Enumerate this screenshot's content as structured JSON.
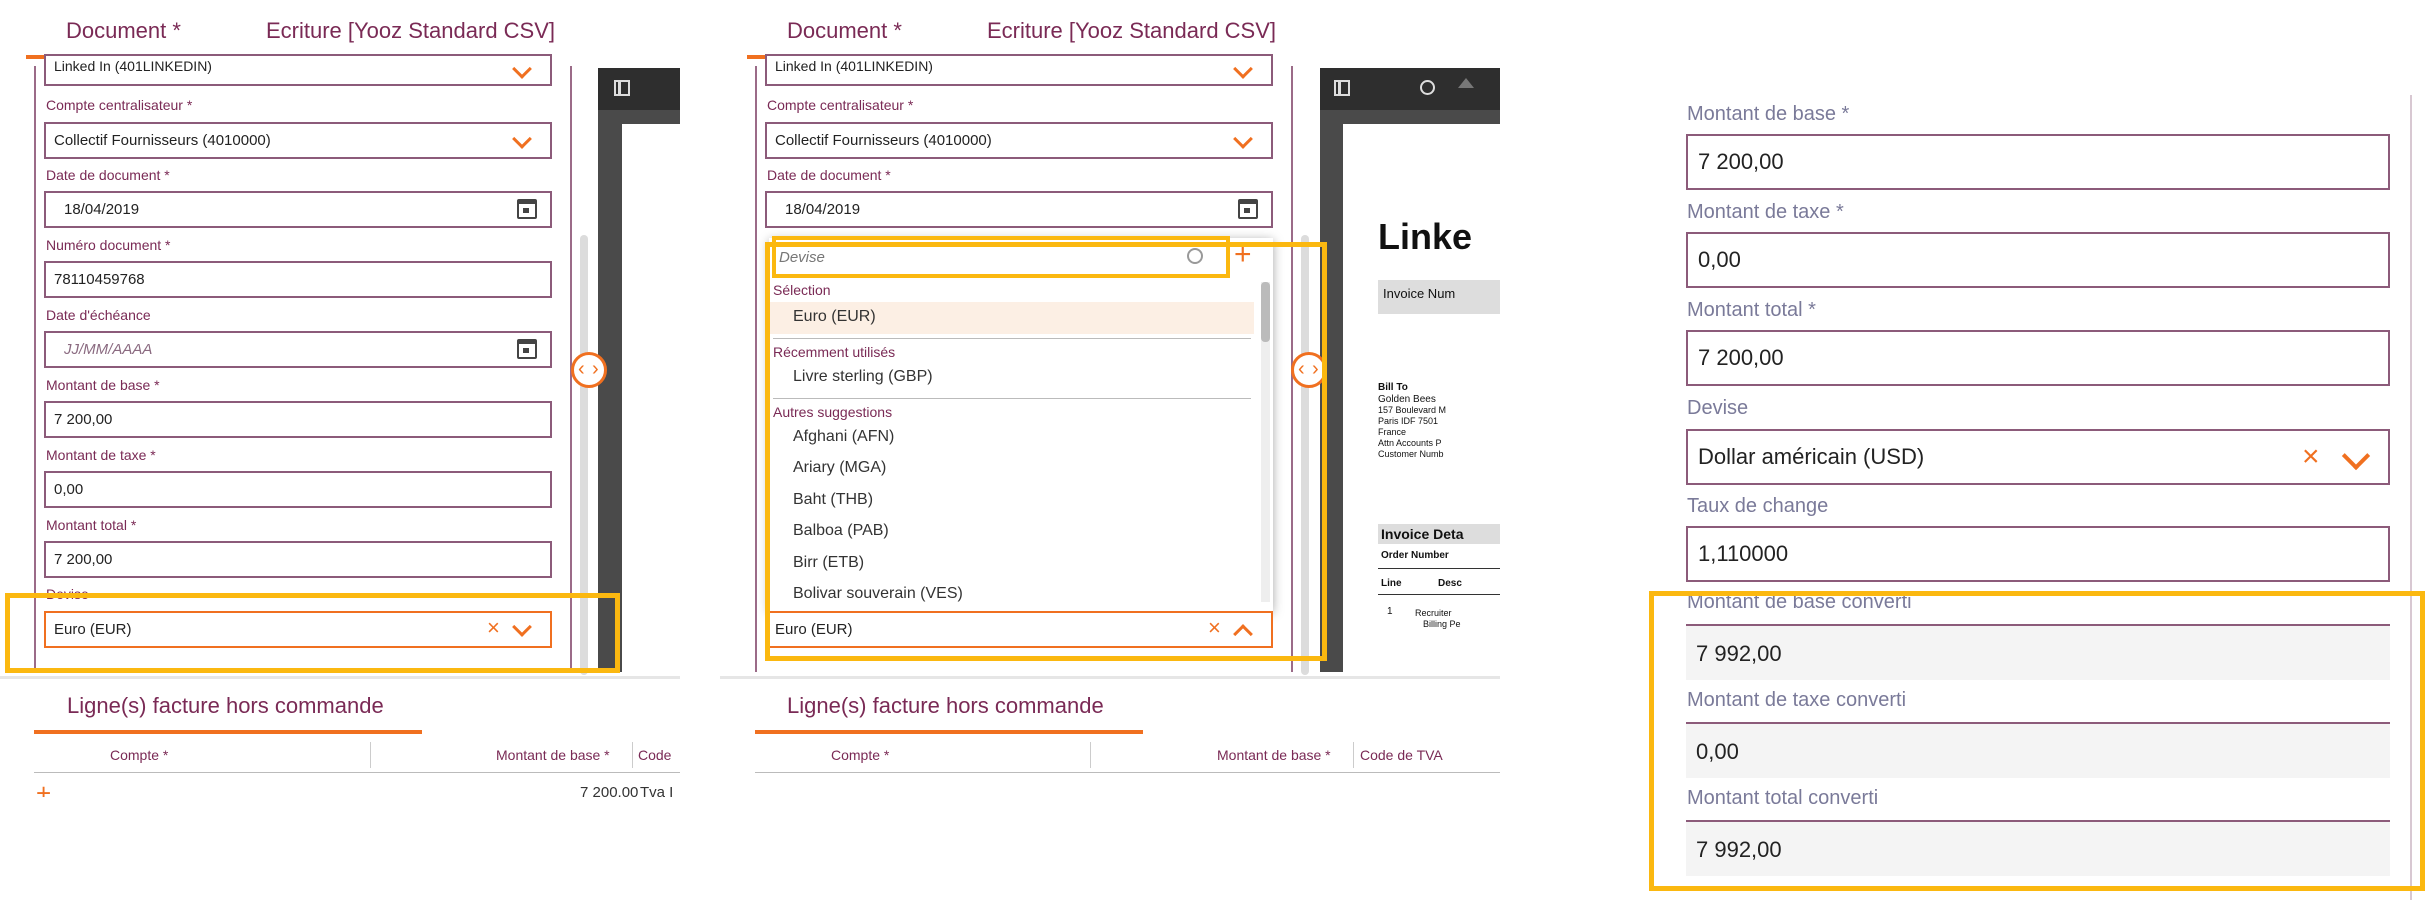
{
  "tabs": {
    "document": "Document *",
    "ecriture": "Ecriture [Yooz Standard CSV]"
  },
  "form": {
    "supplier_value": "Linked In (401LINKEDIN)",
    "compte_label": "Compte centralisateur *",
    "compte_value": "Collectif Fournisseurs (4010000)",
    "date_doc_label": "Date de document *",
    "date_doc_value": "18/04/2019",
    "num_doc_label": "Numéro document *",
    "num_doc_value": "78110459768",
    "date_echeance_label": "Date d'échéance",
    "date_echeance_placeholder": "JJ/MM/AAAA",
    "base_label": "Montant de base *",
    "base_value": "7 200,00",
    "taxe_label": "Montant de taxe *",
    "taxe_value": "0,00",
    "total_label": "Montant total *",
    "total_value": "7 200,00",
    "devise_label": "Devise",
    "devise_value": "Euro (EUR)"
  },
  "lines": {
    "title": "Ligne(s) facture hors commande",
    "col_compte": "Compte *",
    "col_base": "Montant de base *",
    "col_code_short": "Code",
    "col_code": "Code de TVA",
    "row_amount": "7 200,00",
    "row_code": "Tva I"
  },
  "dropdown": {
    "search_placeholder": "Devise",
    "group_selection": "Sélection",
    "selected": "Euro (EUR)",
    "group_recent": "Récemment utilisés",
    "recent": [
      "Livre sterling (GBP)"
    ],
    "group_other": "Autres suggestions",
    "others": [
      "Afghani (AFN)",
      "Ariary (MGA)",
      "Baht (THB)",
      "Balboa (PAB)",
      "Birr (ETB)",
      "Bolivar souverain (VES)"
    ]
  },
  "pdf": {
    "company": "Linke",
    "invoice_num": "Invoice Num",
    "bill_to": "Bill To",
    "bill_lines": [
      "Golden Bees",
      "157 Boulevard M",
      "Paris  IDF 7501",
      "France",
      "Attn Accounts P",
      "Customer Numb"
    ],
    "invoice_details": "Invoice Deta",
    "order_number": "Order Number",
    "line": "Line",
    "desc": "Desc",
    "row_num": "1",
    "row_desc1": "Recruiter",
    "row_desc2": "Billing Pe"
  },
  "right_panel": {
    "base_label": "Montant de base *",
    "base_value": "7 200,00",
    "taxe_label": "Montant de taxe *",
    "taxe_value": "0,00",
    "total_label": "Montant total *",
    "total_value": "7 200,00",
    "devise_label": "Devise",
    "devise_value": "Dollar américain (USD)",
    "rate_label": "Taux de change",
    "rate_value": "1,110000",
    "conv_base_label": "Montant de base converti",
    "conv_base_value": "7 992,00",
    "conv_taxe_label": "Montant de taxe converti",
    "conv_taxe_value": "0,00",
    "conv_total_label": "Montant total converti",
    "conv_total_value": "7 992,00"
  },
  "colors": {
    "accent": "#f07020",
    "highlight": "#fbb810",
    "brand": "#7a2a55"
  },
  "icons": [
    "calendar-icon",
    "chevron-down-icon",
    "close-icon",
    "search-icon",
    "plus-icon",
    "sidebar-toggle-icon",
    "zoom-icon",
    "upload-icon",
    "expand-collapse-icon"
  ]
}
